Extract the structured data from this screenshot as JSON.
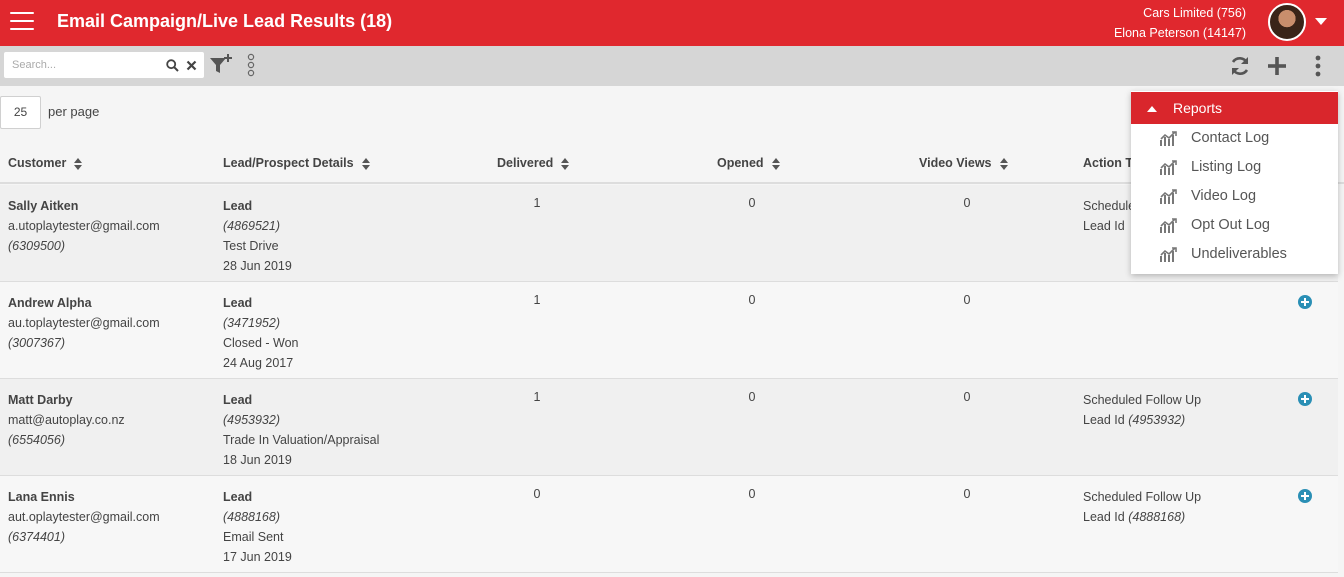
{
  "header": {
    "title": "Email Campaign/Live Lead Results (18)",
    "company": "Cars Limited (756)",
    "user": "Elona Peterson (14147)",
    "brand_color": "#e0282e"
  },
  "toolbar": {
    "search_placeholder": "Search...",
    "icons": [
      "search-icon",
      "clear-icon",
      "filter-add-icon",
      "column-toggle-icon",
      "refresh-icon",
      "add-icon",
      "more-vert-icon"
    ]
  },
  "pagination": {
    "per_page_value": "25",
    "per_page_label": "per page"
  },
  "table": {
    "columns": [
      "Customer",
      "Lead/Prospect Details",
      "Delivered",
      "Opened",
      "Video Views",
      "Action T"
    ],
    "rows": [
      {
        "name": "Sally Aitken",
        "email": "a.utoplaytester@gmail.com",
        "customer_id": "(6309500)",
        "lead_type": "Lead",
        "lead_id": "(4869521)",
        "status": "Test Drive",
        "date": "28 Jun 2019",
        "delivered": "1",
        "opened": "0",
        "video_views": "0",
        "action_title": "Scheduled",
        "action_lead_prefix": "Lead Id",
        "action_lead_id": "",
        "has_add": false
      },
      {
        "name": "Andrew Alpha",
        "email": "au.toplaytester@gmail.com",
        "customer_id": "(3007367)",
        "lead_type": "Lead",
        "lead_id": "(3471952)",
        "status": "Closed - Won",
        "date": "24 Aug 2017",
        "delivered": "1",
        "opened": "0",
        "video_views": "0",
        "action_title": "",
        "action_lead_prefix": "",
        "action_lead_id": "",
        "has_add": true
      },
      {
        "name": "Matt Darby",
        "email": "matt@autoplay.co.nz",
        "customer_id": "(6554056)",
        "lead_type": "Lead",
        "lead_id": "(4953932)",
        "status": "Trade In Valuation/Appraisal",
        "date": "18 Jun 2019",
        "delivered": "1",
        "opened": "0",
        "video_views": "0",
        "action_title": "Scheduled Follow Up",
        "action_lead_prefix": "Lead Id",
        "action_lead_id": "(4953932)",
        "has_add": true
      },
      {
        "name": "Lana Ennis",
        "email": "aut.oplaytester@gmail.com",
        "customer_id": "(6374401)",
        "lead_type": "Lead",
        "lead_id": "(4888168)",
        "status": "Email Sent",
        "date": "17 Jun 2019",
        "delivered": "0",
        "opened": "0",
        "video_views": "0",
        "action_title": "Scheduled Follow Up",
        "action_lead_prefix": "Lead Id",
        "action_lead_id": "(4888168)",
        "has_add": true
      }
    ]
  },
  "reports_menu": {
    "header": "Reports",
    "items": [
      "Contact Log",
      "Listing Log",
      "Video Log",
      "Opt Out Log",
      "Undeliverables"
    ],
    "item_icon": "chart-line-icon"
  }
}
